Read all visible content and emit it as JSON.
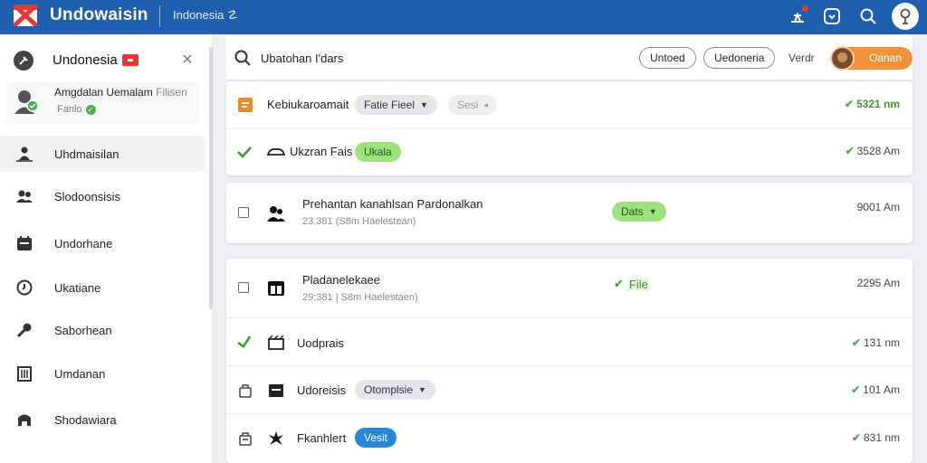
{
  "topbar": {
    "app_title": "Undowaisin",
    "country": "Indonesia ☡",
    "icons": [
      "flag-logo",
      "notification-icon",
      "chat-icon",
      "search-icon",
      "user-avatar"
    ]
  },
  "sidebar": {
    "header_title": "Undonesia",
    "user": {
      "name": "Amgdalan Uemalam",
      "name_suffix": "Filisen",
      "sub": "Fanlo"
    },
    "items": [
      {
        "label": "Uhdmaisilan",
        "icon": "people-icon",
        "active": true
      },
      {
        "label": "Slodoonsisis",
        "icon": "group-icon",
        "active": false
      },
      {
        "label": "Undorhane",
        "icon": "calendar-icon",
        "active": false
      },
      {
        "label": "Ukatiane",
        "icon": "clock-icon",
        "active": false
      },
      {
        "label": "Saborhean",
        "icon": "wrench-icon",
        "active": false
      },
      {
        "label": "Umdanan",
        "icon": "building-icon",
        "active": false
      },
      {
        "label": "Shodawiara",
        "icon": "archive-icon",
        "active": false
      }
    ]
  },
  "search": {
    "value": "Ubatohan I'dars",
    "buttons": [
      "Untoed",
      "Uedoneria"
    ],
    "text_link": "Verdr",
    "profile_label": "Oanan"
  },
  "rows": [
    {
      "title": "Kebiukaroamait",
      "chip": "Fatie Fieel",
      "chip2": "Sesi",
      "time": "5321 nm"
    },
    {
      "title": "Ukzran Fais",
      "chip": "Ukala",
      "time": "3528 Am"
    },
    {
      "title": "Prehantan kanahlsan Pardonalkan",
      "sub": "23,381 (S8m Haelestean)",
      "chip": "Dats",
      "time": "9001 Am"
    },
    {
      "title": "Pladanelekaee",
      "sub": "29:381 | S8m Haelestaen)",
      "status": "File",
      "time": "2295 Am"
    },
    {
      "title": "Uodprais",
      "time": "131 nm"
    },
    {
      "title": "Udoreisis",
      "chip": "Otomplsie",
      "time": "101 Am"
    },
    {
      "title": "Fkanhlert",
      "chip": "Vesit",
      "time": "831 nm"
    }
  ],
  "colors": {
    "topbar": "#1f5fb0",
    "accent_orange": "#f0923a",
    "chip_green": "#9ee27f",
    "chip_blue": "#2786d6",
    "status_green": "#4caf50"
  }
}
